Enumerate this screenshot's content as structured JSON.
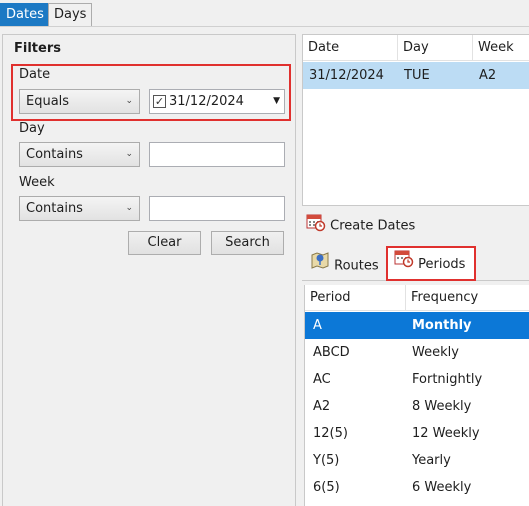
{
  "tabs": [
    {
      "label": "Dates",
      "active": true
    },
    {
      "label": "Days",
      "active": false
    }
  ],
  "filters": {
    "title": "Filters",
    "date": {
      "label": "Date",
      "operator": "Equals",
      "value": "31/12/2024",
      "checked": true
    },
    "day": {
      "label": "Day",
      "operator": "Contains",
      "value": ""
    },
    "week": {
      "label": "Week",
      "operator": "Contains",
      "value": ""
    },
    "clear_label": "Clear",
    "search_label": "Search"
  },
  "dates_grid": {
    "columns": [
      "Date",
      "Day",
      "Week"
    ],
    "rows": [
      {
        "date": "31/12/2024",
        "day": "TUE",
        "week": "A2"
      }
    ]
  },
  "create_dates_label": "Create Dates",
  "bottom_tabs": [
    {
      "label": "Routes",
      "icon": "route-map-icon"
    },
    {
      "label": "Periods",
      "icon": "calendar-clock-icon"
    }
  ],
  "periods": {
    "columns": [
      "Period",
      "Frequency"
    ],
    "rows": [
      {
        "period": "A",
        "frequency": "Monthly",
        "selected": true
      },
      {
        "period": "ABCD",
        "frequency": "Weekly"
      },
      {
        "period": "AC",
        "frequency": "Fortnightly"
      },
      {
        "period": "A2",
        "frequency": "8 Weekly"
      },
      {
        "period": "12(5)",
        "frequency": "12 Weekly"
      },
      {
        "period": "Y(5)",
        "frequency": "Yearly"
      },
      {
        "period": "6(5)",
        "frequency": "6 Weekly"
      }
    ]
  },
  "colors": {
    "accent": "#1c79c4",
    "selection": "#0c78d7",
    "row_highlight": "#bcdcf4",
    "annotation": "#e0302e"
  }
}
